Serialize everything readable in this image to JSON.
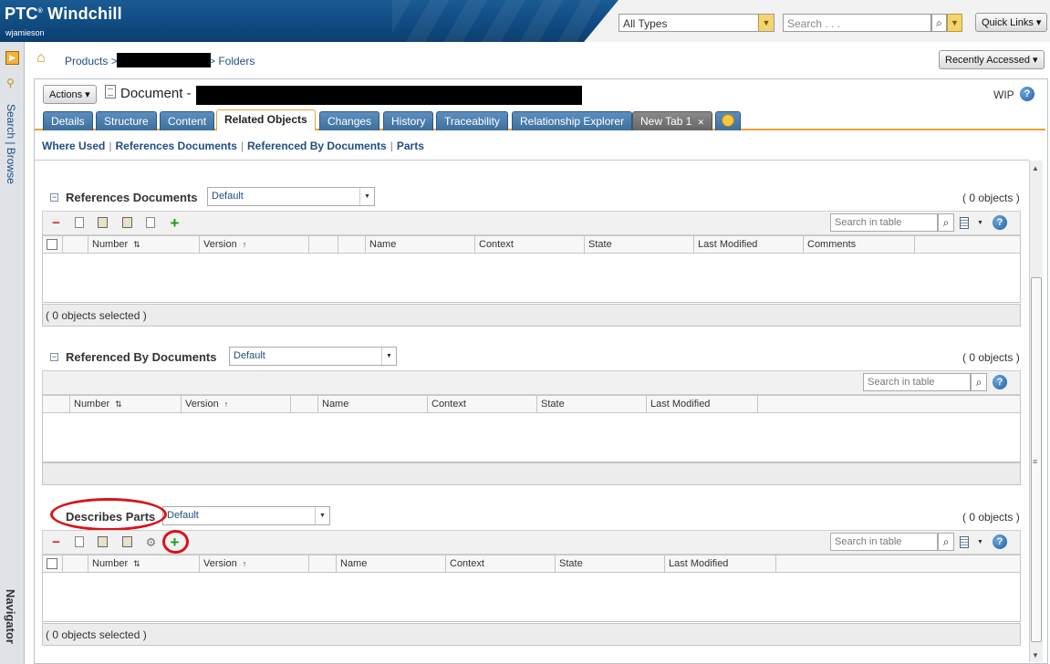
{
  "header": {
    "brand": "PTC",
    "product": "Windchill",
    "username": "wjamieson",
    "type_select": "All Types",
    "search_placeholder": "Search . . .",
    "quick_links": "Quick Links ▾"
  },
  "navigator": {
    "search_browse": "Search | Browse",
    "label": "Navigator"
  },
  "breadcrumb": {
    "products": "Products >",
    "folders": "> Folders",
    "recently_accessed": "Recently Accessed ▾"
  },
  "document": {
    "actions": "Actions ▾",
    "title_prefix": "Document -",
    "state_label": "WIP"
  },
  "tabs": [
    {
      "label": "Details"
    },
    {
      "label": "Structure"
    },
    {
      "label": "Content"
    },
    {
      "label": "Related Objects"
    },
    {
      "label": "Changes"
    },
    {
      "label": "History"
    },
    {
      "label": "Traceability"
    },
    {
      "label": "Relationship Explorer"
    },
    {
      "label": "New Tab 1"
    }
  ],
  "sublinks": [
    "Where Used",
    "References Documents",
    "Referenced By Documents",
    "Parts"
  ],
  "common": {
    "search_in_table": "Search in table",
    "view_default": "Default",
    "help": "?",
    "sort_up_down": "⇅",
    "sort_up": "↑"
  },
  "sections": {
    "references": {
      "title": "References Documents",
      "count": "( 0 objects )",
      "footer": "( 0 objects selected )",
      "columns": [
        "Number",
        "Version",
        "Name",
        "Context",
        "State",
        "Last Modified",
        "Comments"
      ]
    },
    "referenced_by": {
      "title": "Referenced By Documents",
      "count": "( 0 objects )",
      "columns": [
        "Number",
        "Version",
        "Name",
        "Context",
        "State",
        "Last Modified"
      ]
    },
    "describes": {
      "title": "Describes Parts",
      "count": "( 0 objects )",
      "footer": "( 0 objects selected )",
      "columns": [
        "Number",
        "Version",
        "Name",
        "Context",
        "State",
        "Last Modified"
      ]
    }
  },
  "colors": {
    "header_blue": "#1b5a93",
    "tab_blue": "#3d6f9e",
    "tab_accent": "#e8a13a",
    "link": "#1f4e82",
    "annotation_red": "#d8121a"
  }
}
